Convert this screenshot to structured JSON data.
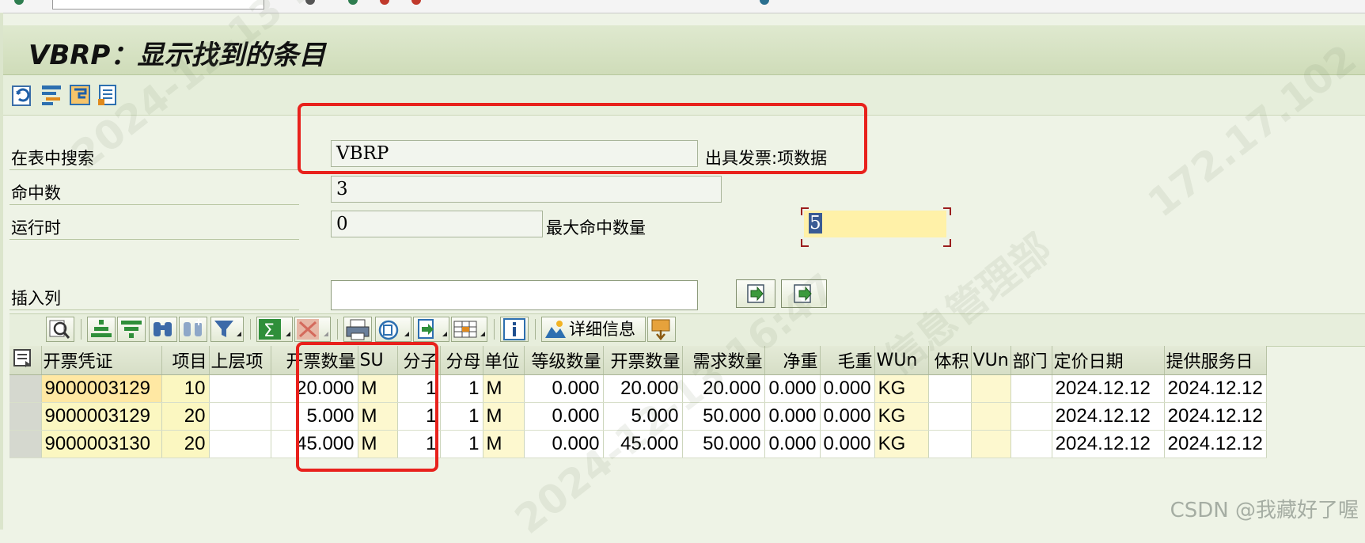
{
  "title": "VBRP：显示找到的条目",
  "toolbar_icons": [
    "refresh-icon",
    "selection-options-icon",
    "table-settings-icon",
    "list-print-icon"
  ],
  "form": {
    "search_table_label": "在表中搜索",
    "search_table_value": "VBRP",
    "search_table_desc": "出具发票:项数据",
    "hit_count_label": "命中数",
    "hit_count_value": "3",
    "runtime_label": "运行时",
    "runtime_value": "0",
    "max_hits_label": "最大命中数量",
    "max_hits_value": "5",
    "insert_column_label": "插入列",
    "insert_column_value": ""
  },
  "alv_toolbar": {
    "details_label": "详细信息"
  },
  "grid": {
    "columns": [
      "开票凭证",
      "项目",
      "上层项",
      "开票数量",
      "SU",
      "分子",
      "分母",
      "单位",
      "等级数量",
      "开票数量",
      "需求数量",
      "净重",
      "毛重",
      "WUn",
      "体积",
      "VUn",
      "部门",
      "定价日期",
      "提供服务日"
    ],
    "rows": [
      [
        "9000003129",
        "10",
        "",
        "20.000",
        "M",
        "1",
        "1",
        "M",
        "0.000",
        "20.000",
        "20.000",
        "0.000",
        "0.000",
        "KG",
        "",
        "",
        "",
        "2024.12.12",
        "2024.12.12"
      ],
      [
        "9000003129",
        "20",
        "",
        "5.000",
        "M",
        "1",
        "1",
        "M",
        "0.000",
        "5.000",
        "50.000",
        "0.000",
        "0.000",
        "KG",
        "",
        "",
        "",
        "2024.12.12",
        "2024.12.12"
      ],
      [
        "9000003130",
        "20",
        "",
        "45.000",
        "M",
        "1",
        "1",
        "M",
        "0.000",
        "45.000",
        "50.000",
        "0.000",
        "0.000",
        "KG",
        "",
        "",
        "",
        "2024.12.12",
        "2024.12.12"
      ]
    ]
  },
  "watermarks": [
    "2024-12-13 16:47",
    "172.17.102",
    "信息管理部"
  ],
  "csdn_watermark": "CSDN @我藏好了喔",
  "colors": {
    "highlight_red": "#e8211c",
    "title_bg": "#d6e2c4",
    "key_cell": "#fbf7c1",
    "input_focus": "#fff1a8"
  }
}
